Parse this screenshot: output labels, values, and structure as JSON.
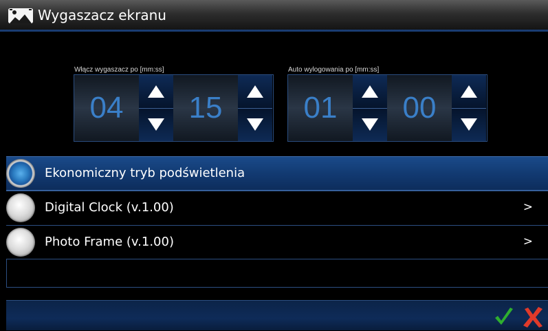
{
  "window": {
    "title": "Wygaszacz ekranu",
    "icon": "screensaver-image-icon"
  },
  "screensaver_timer": {
    "label": "Włącz wygaszacz po [mm:ss]",
    "minutes": "04",
    "seconds": "15"
  },
  "logout_timer": {
    "label": "Auto wylogowania po [mm:ss]",
    "minutes": "01",
    "seconds": "00"
  },
  "options": [
    {
      "label": "Ekonomiczny tryb podświetlenia",
      "selected": true,
      "chevron": ""
    },
    {
      "label": "Digital Clock (v.1.00)",
      "selected": false,
      "chevron": ">"
    },
    {
      "label": "Photo Frame (v.1.00)",
      "selected": false,
      "chevron": ">"
    }
  ],
  "footer": {
    "confirm_icon": "checkmark-icon",
    "cancel_icon": "close-x-icon"
  },
  "colors": {
    "accent_blue": "#123a72",
    "digit_blue": "#3a7fc8",
    "confirm_green": "#2fae2f",
    "cancel_red": "#e03a2a"
  }
}
